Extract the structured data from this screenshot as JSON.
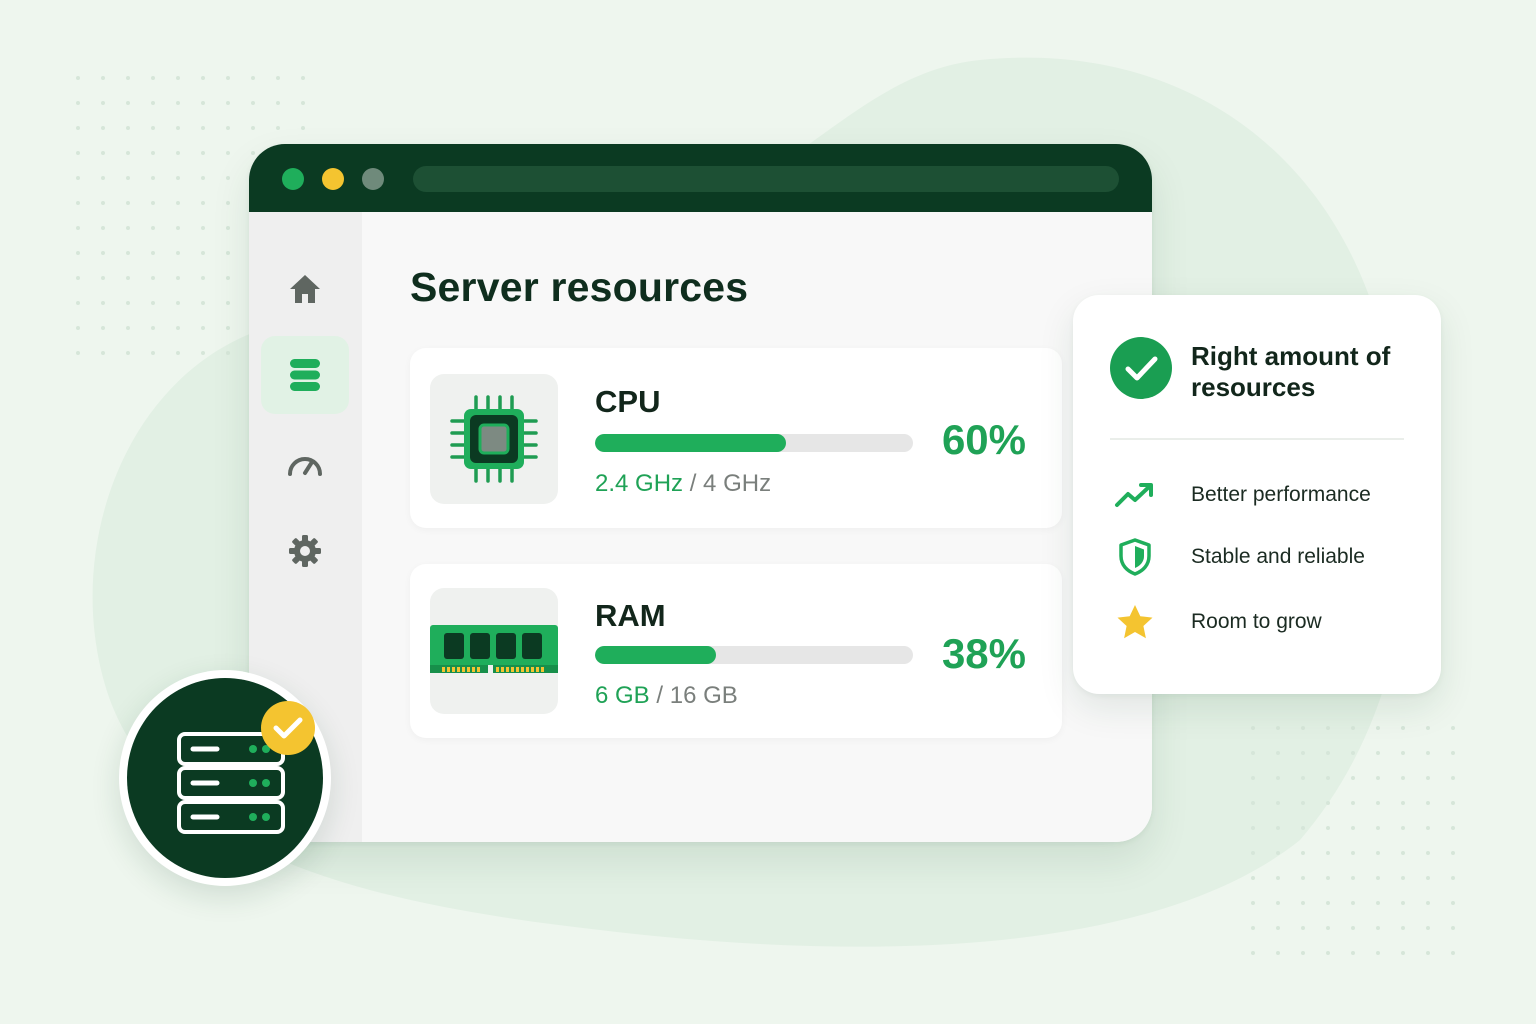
{
  "window": {
    "title_bar": {
      "controls": [
        "close",
        "minimize",
        "maximize"
      ]
    }
  },
  "sidebar": {
    "items": [
      {
        "name": "home",
        "icon": "home-icon",
        "active": false
      },
      {
        "name": "servers",
        "icon": "server-stack-icon",
        "active": true
      },
      {
        "name": "performance",
        "icon": "gauge-icon",
        "active": false
      },
      {
        "name": "settings",
        "icon": "gear-icon",
        "active": false
      }
    ]
  },
  "main": {
    "title": "Server resources",
    "resources": [
      {
        "label": "CPU",
        "icon": "cpu-chip-icon",
        "used": "2.4 GHz",
        "separator": " / ",
        "total": "4 GHz",
        "percent_label": "60%",
        "usage_fraction": 0.6
      },
      {
        "label": "RAM",
        "icon": "ram-module-icon",
        "used": "6 GB",
        "separator": " / ",
        "total": "16 GB",
        "percent_label": "38%",
        "usage_fraction": 0.38
      }
    ]
  },
  "benefits": {
    "title": "Right amount of resources",
    "icon": "check-circle-icon",
    "items": [
      {
        "label": "Better performance",
        "icon": "trend-up-icon"
      },
      {
        "label": "Stable and reliable",
        "icon": "shield-check-icon"
      },
      {
        "label": "Room to grow",
        "icon": "star-icon"
      }
    ]
  },
  "server_badge": {
    "icon": "server-icon",
    "status_icon": "check-icon"
  },
  "colors": {
    "accent_green": "#1fae5b",
    "dark_green": "#0b3a22",
    "yellow": "#f4c430",
    "background": "#eef6ee"
  }
}
